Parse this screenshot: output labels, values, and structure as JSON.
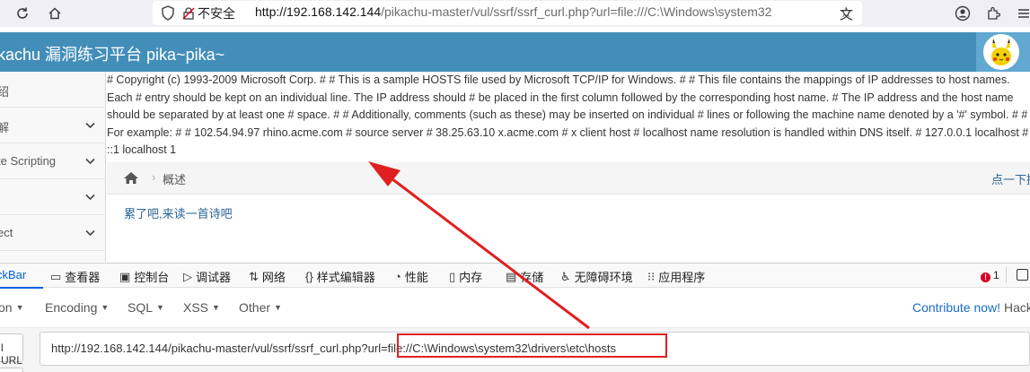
{
  "browser": {
    "insecure_label": "不安全",
    "url_host": "http://192.168.142.144",
    "url_path": "/pikachu-master/vul/ssrf/ssrf_curl.php?url=file:///C:\\Windows\\system32"
  },
  "header": {
    "title": "kachu 漏洞练习平台 pika~pika~"
  },
  "sidebar": {
    "items": [
      {
        "label": "绍",
        "has_chevron": false
      },
      {
        "label": "解",
        "has_chevron": true
      },
      {
        "label": "te Scripting",
        "has_chevron": true
      },
      {
        "label": "",
        "has_chevron": true
      },
      {
        "label": "ect",
        "has_chevron": true
      }
    ]
  },
  "content": {
    "hosts_text": "# Copyright (c) 1993-2009 Microsoft Corp. # # This is a sample HOSTS file used by Microsoft TCP/IP for Windows. # # This file contains the mappings of IP addresses to host names. Each # entry should be kept on an individual line. The IP address should # be placed in the first column followed by the corresponding host name. # The IP address and the host name should be separated by at least one # space. # # Additionally, comments (such as these) may be inserted on individual # lines or following the machine name denoted by a '#' symbol. # # For example: # # 102.54.94.97 rhino.acme.com # source server # 38.25.63.10 x.acme.com # x client host # localhost name resolution is handled within DNS itself. # 127.0.0.1 localhost # ::1 localhost 1",
    "breadcrumb": "概述",
    "right_link": "点一下提示",
    "poem_link": "累了吧,来读一首诗吧"
  },
  "devtools": {
    "tabs": [
      {
        "label": "ckBar",
        "icon": "hackbar",
        "active": true
      },
      {
        "label": "查看器",
        "icon": "inspector-icon"
      },
      {
        "label": "控制台",
        "icon": "console-icon"
      },
      {
        "label": "调试器",
        "icon": "debugger-icon"
      },
      {
        "label": "网络",
        "icon": "network-icon"
      },
      {
        "label": "样式编辑器",
        "icon": "style-editor-icon"
      },
      {
        "label": "性能",
        "icon": "performance-icon"
      },
      {
        "label": "内存",
        "icon": "memory-icon"
      },
      {
        "label": "存储",
        "icon": "storage-icon"
      },
      {
        "label": "无障碍环境",
        "icon": "accessibility-icon"
      },
      {
        "label": "应用程序",
        "icon": "application-icon"
      }
    ],
    "error_count": "1"
  },
  "hackbar": {
    "menu": [
      "on",
      "Encoding",
      "SQL",
      "XSS",
      "Other"
    ],
    "contribute_label": "Contribute now!",
    "contribute_suffix": " Hack",
    "load_label": "l URL",
    "url_value": "http://192.168.142.144/pikachu-master/vul/ssrf/ssrf_curl.php?url=file://C:\\Windows\\system32\\drivers\\etc\\hosts"
  },
  "colors": {
    "header_bg": "#438eb9",
    "link": "#2a6496",
    "annotation_red": "#e02020"
  }
}
